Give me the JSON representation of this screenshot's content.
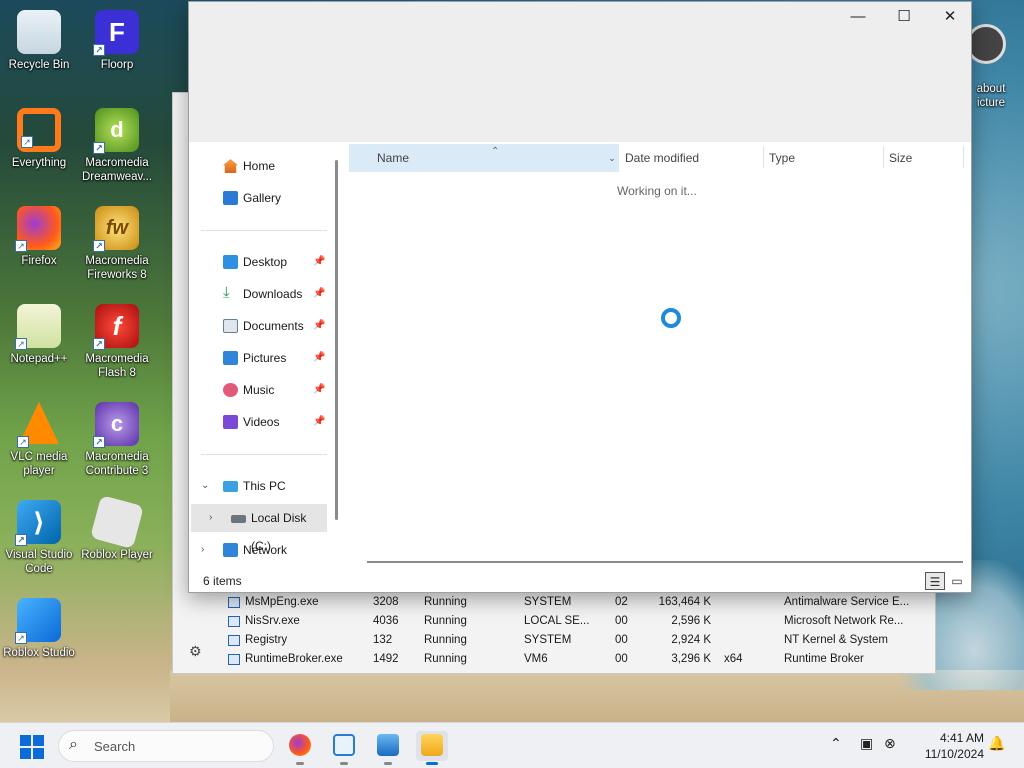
{
  "desktop": {
    "icons": [
      {
        "label": "Recycle Bin"
      },
      {
        "label": "Floorp"
      },
      {
        "label": "Everything"
      },
      {
        "label": "Macromedia Dreamweav..."
      },
      {
        "label": "Firefox"
      },
      {
        "label": "Macromedia Fireworks 8"
      },
      {
        "label": "Notepad++"
      },
      {
        "label": "Macromedia Flash 8"
      },
      {
        "label": "VLC media player"
      },
      {
        "label": "Macromedia Contribute 3"
      },
      {
        "label": "Visual Studio Code"
      },
      {
        "label": "Roblox Player"
      },
      {
        "label": "Roblox Studio"
      }
    ],
    "partial_icon_label": "about\nicture"
  },
  "task_manager": {
    "rows": [
      {
        "name": "MsMpEng.exe",
        "pid": "3208",
        "status": "Running",
        "user": "SYSTEM",
        "cpu": "02",
        "memory": "163,464 K",
        "arch": "",
        "description": "Antimalware Service E..."
      },
      {
        "name": "NisSrv.exe",
        "pid": "4036",
        "status": "Running",
        "user": "LOCAL SE...",
        "cpu": "00",
        "memory": "2,596 K",
        "arch": "",
        "description": "Microsoft Network Re..."
      },
      {
        "name": "Registry",
        "pid": "132",
        "status": "Running",
        "user": "SYSTEM",
        "cpu": "00",
        "memory": "2,924 K",
        "arch": "",
        "description": "NT Kernel & System"
      },
      {
        "name": "RuntimeBroker.exe",
        "pid": "1492",
        "status": "Running",
        "user": "VM6",
        "cpu": "00",
        "memory": "3,296 K",
        "arch": "x64",
        "description": "Runtime Broker"
      }
    ]
  },
  "explorer": {
    "window_controls": {
      "minimize": "—",
      "maximize": "☐",
      "close": "✕"
    },
    "nav": {
      "home": "Home",
      "gallery": "Gallery",
      "desktop": "Desktop",
      "downloads": "Downloads",
      "documents": "Documents",
      "pictures": "Pictures",
      "music": "Music",
      "videos": "Videos",
      "this_pc": "This PC",
      "local_disk": "Local Disk (C:)",
      "network": "Network"
    },
    "columns": {
      "name": "Name",
      "date_modified": "Date modified",
      "type": "Type",
      "size": "Size"
    },
    "working_text": "Working on it...",
    "status_items": "6 items"
  },
  "taskbar": {
    "search_placeholder": "Search",
    "time": "4:41 AM",
    "date": "11/10/2024"
  }
}
